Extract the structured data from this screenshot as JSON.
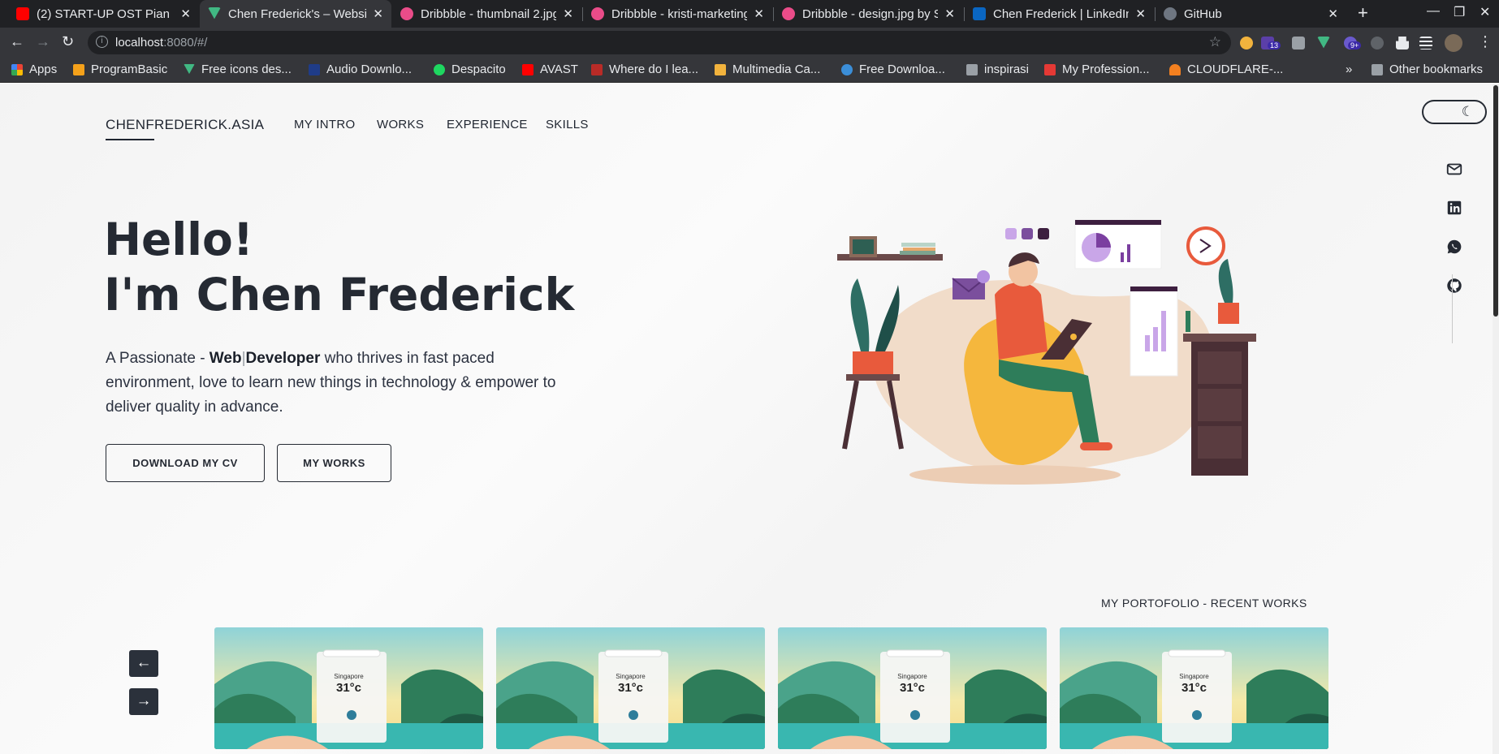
{
  "browser": {
    "tabs": [
      {
        "title": "(2) START-UP OST Pian",
        "favicon_color": "#ff0000",
        "active": false
      },
      {
        "title": "Chen Frederick's – Website",
        "favicon_color": "#41b883",
        "active": true
      },
      {
        "title": "Dribbble - thumbnail 2.jpg",
        "favicon_color": "#ea4c89",
        "active": false
      },
      {
        "title": "Dribbble - kristi-marketing",
        "favicon_color": "#ea4c89",
        "active": false
      },
      {
        "title": "Dribbble - design.jpg by S",
        "favicon_color": "#ea4c89",
        "active": false
      },
      {
        "title": "Chen Frederick | LinkedIn",
        "favicon_color": "#0a66c2",
        "active": false
      },
      {
        "title": "GitHub",
        "favicon_color": "#6e7681",
        "active": false
      }
    ],
    "url_host": "localhost",
    "url_rest": ":8080/#/",
    "extension_badges": [
      "13",
      "9+"
    ],
    "bookmarks": [
      {
        "label": "Apps",
        "color": "#ea4335"
      },
      {
        "label": "ProgramBasic",
        "color": "#f4a11a"
      },
      {
        "label": "Free icons des...",
        "color": "#41b883"
      },
      {
        "label": "Audio Downlo...",
        "color": "#1f3c88"
      },
      {
        "label": "Despacito",
        "color": "#1ed760"
      },
      {
        "label": "AVAST",
        "color": "#ff0000"
      },
      {
        "label": "Where do I lea...",
        "color": "#b92b27"
      },
      {
        "label": "Multimedia Ca...",
        "color": "#f2b33d"
      },
      {
        "label": "Free Downloa...",
        "color": "#3b8ed8"
      },
      {
        "label": "inspirasi",
        "color": "#9aa0a6"
      },
      {
        "label": "My Profession...",
        "color": "#e53935"
      },
      {
        "label": "CLOUDFLARE-...",
        "color": "#f38020"
      }
    ],
    "overflow": "»",
    "other_bookmarks": "Other bookmarks"
  },
  "site": {
    "brand": "CHENFREDERICK.ASIA",
    "nav": [
      "MY INTRO",
      "WORKS",
      "EXPERIENCE",
      "SKILLS"
    ],
    "hero": {
      "line1": "Hello!",
      "line2": "I'm Chen Frederick",
      "p_prefix": "A Passionate - ",
      "p_web": "Web",
      "p_sep": "|",
      "p_dev": "Developer",
      "p_suffix": " who thrives in fast paced environment, love to learn new things in technology & empower to deliver quality in advance."
    },
    "buttons": {
      "cv": "DOWNLOAD MY CV",
      "works": "MY WORKS"
    },
    "portfolio_title": "MY PORTOFOLIO - RECENT WORKS",
    "arrows": {
      "prev": "←",
      "next": "→"
    },
    "cards": [
      {
        "city": "Singapore",
        "temp": "31°c"
      },
      {
        "city": "Singapore",
        "temp": "31°c"
      },
      {
        "city": "Singapore",
        "temp": "31°c"
      },
      {
        "city": "Singapore",
        "temp": "31°c"
      }
    ]
  },
  "icons": [
    "moon-icon",
    "mail-icon",
    "linkedin-icon",
    "whatsapp-icon",
    "github-icon"
  ],
  "colors": {
    "primary": "#252a33",
    "accent": "#e85a3c",
    "purple": "#7b3fa0"
  }
}
